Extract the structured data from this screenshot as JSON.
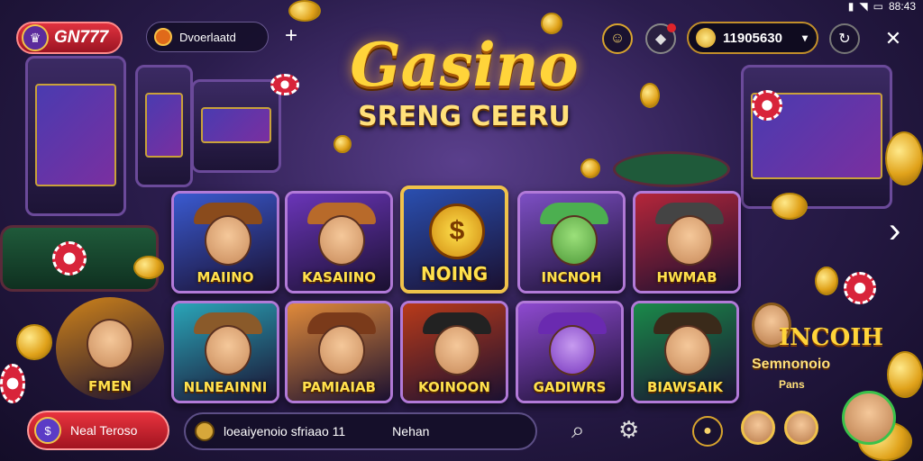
{
  "status_bar": {
    "time": "88:43"
  },
  "header": {
    "brand": "GN777",
    "search_value": "Dvoerlaatd",
    "add_symbol": "+",
    "balance": "11905630",
    "balance_chevron": "▾"
  },
  "hero": {
    "title": "Gasino",
    "subtitle": "SRENG CEERU"
  },
  "games": [
    {
      "label": "MAIINO",
      "bg": "#3a5ad0",
      "hat": "#8a4b1c"
    },
    {
      "label": "KASAIINO",
      "bg": "#6a35b8",
      "hat": "#b86a2a"
    },
    {
      "label": "NOING",
      "bg": "#2a4fb0",
      "hat": "#d4a017"
    },
    {
      "label": "INCNOH",
      "bg": "#7d4fc4",
      "hat": "#4caf50"
    },
    {
      "label": "HWMAB",
      "bg": "#b5263a",
      "hat": "#444444"
    },
    {
      "label": "FMEN",
      "bg": "#d0841a",
      "hat": "#c89a2a"
    },
    {
      "label": "NLNEAINNI",
      "bg": "#2aa5b8",
      "hat": "#8a5a2a"
    },
    {
      "label": "PAMIAIAB",
      "bg": "#e08a3a",
      "hat": "#7a3a1a"
    },
    {
      "label": "KOINOON",
      "bg": "#b83a1a",
      "hat": "#222222"
    },
    {
      "label": "GADIWRS",
      "bg": "#8e4ad0",
      "hat": "#6a2ab0"
    },
    {
      "label": "BIAWSAIK",
      "bg": "#1a8a4a",
      "hat": "#3a2a1a"
    }
  ],
  "side_promo": {
    "title": "INCOIH",
    "line1": "Semnonoio",
    "line2": "Pans"
  },
  "footer": {
    "bonus_label": "Neal Teroso",
    "chat_text": "loeaiyenoio sfriaao 11",
    "chat_send": "Nehan"
  }
}
